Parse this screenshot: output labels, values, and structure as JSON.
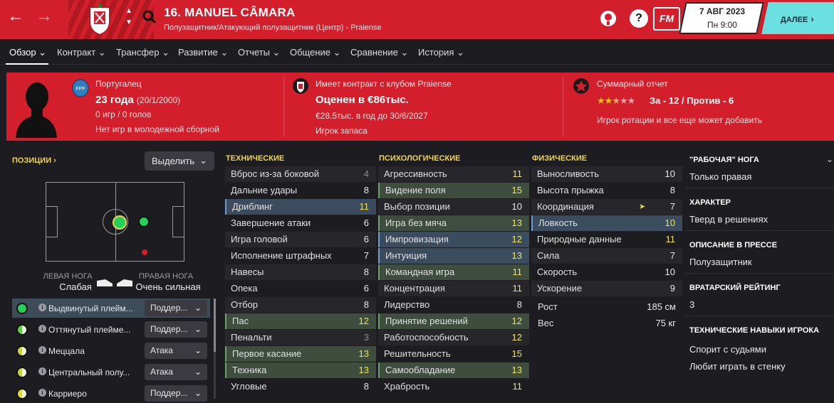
{
  "header": {
    "title": "16. MANUEL CÂMARA",
    "subtitle": "Полузащитник/Атакующий полузащитник (Центр) - Praiense",
    "date": "7 АВГ 2023",
    "time": "Пн 9:00",
    "continue_label": "ДАЛЕЕ",
    "fm_label": "FM",
    "help_label": "?"
  },
  "subnav": [
    "Обзор",
    "Контракт",
    "Трансфер",
    "Развитие",
    "Отчеты",
    "Общение",
    "Сравнение",
    "История"
  ],
  "banner": {
    "nationality": "Португалец",
    "age": "23 года",
    "dob": "(20/1/2000)",
    "games": "0 игр / 0 голов",
    "youth": "Нет игр в молодежной сборной",
    "contract": "Имеет контракт с клубом Praiense",
    "value": "Оценен в €86тыс.",
    "wage": "€28.5тыс. в год до 30/6/2027",
    "role": "Игрок запаса",
    "report_title": "Суммарный отчет",
    "report_stars": 2.5,
    "report_pros": "За - 12 / Против - 6",
    "report_desc": "Игрок ротации и все еще может добавить"
  },
  "positions": {
    "label": "ПОЗИЦИИ ›",
    "select_label": "Выделить",
    "left_foot_label": "ЛЕВАЯ НОГА",
    "left_foot_value": "Слабая",
    "right_foot_label": "ПРАВАЯ НОГА",
    "right_foot_value": "Очень сильная",
    "rows": [
      {
        "name": "Выдвинутый плейм...",
        "duty": "Поддер...",
        "color": "#22d05a"
      },
      {
        "name": "Оттянутый плейме...",
        "duty": "Поддер...",
        "color": "#5fd03f"
      },
      {
        "name": "Меццала",
        "duty": "Атака",
        "color": "#c5d63a"
      },
      {
        "name": "Центральный полу...",
        "duty": "Атака",
        "color": "#c5d63a"
      },
      {
        "name": "Карриеро",
        "duty": "Поддер...",
        "color": "#e5d83a"
      }
    ]
  },
  "technical": {
    "header": "ТЕХНИЧЕСКИЕ",
    "rows": [
      {
        "name": "Вброс из-за боковой",
        "value": "4",
        "style": "dark",
        "low": true
      },
      {
        "name": "Дальние удары",
        "value": "8",
        "style": ""
      },
      {
        "name": "Дриблинг",
        "value": "11",
        "style": "blue"
      },
      {
        "name": "Завершение атаки",
        "value": "6",
        "style": ""
      },
      {
        "name": "Игра головой",
        "value": "6",
        "style": "dark"
      },
      {
        "name": "Исполнение штрафных",
        "value": "7",
        "style": ""
      },
      {
        "name": "Навесы",
        "value": "8",
        "style": "dark"
      },
      {
        "name": "Опека",
        "value": "6",
        "style": ""
      },
      {
        "name": "Отбор",
        "value": "8",
        "style": "dark"
      },
      {
        "name": "Пас",
        "value": "12",
        "style": "green"
      },
      {
        "name": "Пенальти",
        "value": "3",
        "style": "dark",
        "low": true
      },
      {
        "name": "Первое касание",
        "value": "13",
        "style": "green"
      },
      {
        "name": "Техника",
        "value": "13",
        "style": "green"
      },
      {
        "name": "Угловые",
        "value": "8",
        "style": ""
      }
    ]
  },
  "mental": {
    "header": "ПСИХОЛОГИЧЕСКИЕ",
    "rows": [
      {
        "name": "Агрессивность",
        "value": "11",
        "style": "dark",
        "yellow": true
      },
      {
        "name": "Видение поля",
        "value": "15",
        "style": "green"
      },
      {
        "name": "Выбор позиции",
        "value": "10",
        "style": "dark"
      },
      {
        "name": "Игра без мяча",
        "value": "13",
        "style": "green"
      },
      {
        "name": "Импровизация",
        "value": "12",
        "style": "blue"
      },
      {
        "name": "Интуиция",
        "value": "13",
        "style": "blue"
      },
      {
        "name": "Командная игра",
        "value": "11",
        "style": "green"
      },
      {
        "name": "Концентрация",
        "value": "11",
        "style": "dark",
        "yellow": true
      },
      {
        "name": "Лидерство",
        "value": "8",
        "style": ""
      },
      {
        "name": "Принятие решений",
        "value": "12",
        "style": "green"
      },
      {
        "name": "Работоспособность",
        "value": "12",
        "style": "dark",
        "yellow": true
      },
      {
        "name": "Решительность",
        "value": "15",
        "style": "",
        "yellow": true
      },
      {
        "name": "Самообладание",
        "value": "13",
        "style": "green"
      },
      {
        "name": "Храбрость",
        "value": "11",
        "style": "",
        "yellow": true
      }
    ]
  },
  "physical": {
    "header": "ФИЗИЧЕСКИЕ",
    "rows": [
      {
        "name": "Выносливость",
        "value": "10",
        "style": "dark"
      },
      {
        "name": "Высота прыжка",
        "value": "8",
        "style": ""
      },
      {
        "name": "Координация",
        "value": "7",
        "style": "dark"
      },
      {
        "name": "Ловкость",
        "value": "10",
        "style": "blue"
      },
      {
        "name": "Природные данные",
        "value": "11",
        "style": "",
        "yellow": true
      },
      {
        "name": "Сила",
        "value": "7",
        "style": "dark"
      },
      {
        "name": "Скорость",
        "value": "10",
        "style": ""
      },
      {
        "name": "Ускорение",
        "value": "9",
        "style": "dark"
      }
    ],
    "height_label": "Рост",
    "height_value": "185 см",
    "weight_label": "Вес",
    "weight_value": "75 кг"
  },
  "info": {
    "foot_header": "\"РАБОЧАЯ\" НОГА",
    "foot_value": "Только правая",
    "character_header": "ХАРАКТЕР",
    "character_value": "Тверд в решениях",
    "press_header": "ОПИСАНИЕ В ПРЕССЕ",
    "press_value": "Полузащитник",
    "gk_header": "ВРАТАРСКИЙ РЕЙТИНГ",
    "gk_value": "3",
    "skills_header": "ТЕХНИЧЕСКИЕ НАВЫКИ ИГРОКА",
    "skills": [
      "Спорит с судьями",
      "Любит играть в стенку"
    ]
  },
  "colors": {
    "brand_red": "#d21f2b",
    "accent_cyan": "#6be0e0",
    "highlight_yellow": "#f1d54a"
  }
}
